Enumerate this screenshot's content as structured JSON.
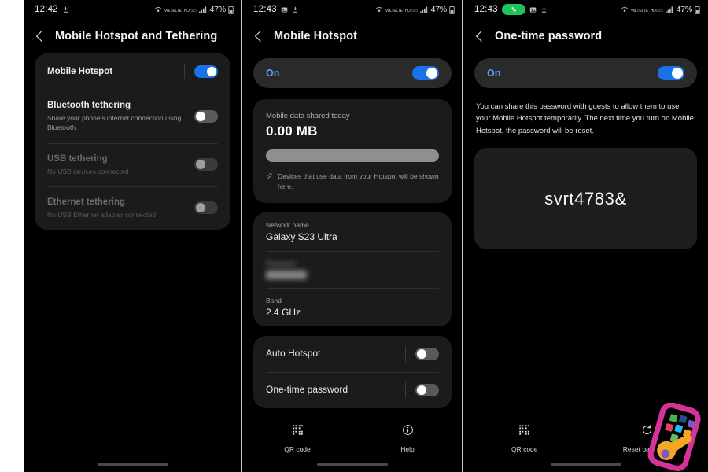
{
  "colors": {
    "accent_blue": "#1b72e8",
    "on_text_blue": "#5b9bf5",
    "call_green": "#1fc25c",
    "card_bg": "#1b1b1b",
    "screen_bg": "#000000",
    "progress_gray": "#8f8f8f"
  },
  "panels": [
    {
      "status_bar": {
        "time": "12:42",
        "battery_percent": "47%",
        "left_icons": [
          "download-icon"
        ],
        "right_icons": [
          "wifi-calling-icon",
          "volte-icon",
          "nfc-icon",
          "signal-bars-icon",
          "battery-icon"
        ]
      },
      "appbar": {
        "back": "back-icon",
        "title": "Mobile Hotspot and Tethering"
      },
      "rows": [
        {
          "title": "Mobile Hotspot",
          "subtitle": "",
          "switch": "on",
          "dim": false,
          "separator_before_switch": true
        },
        {
          "title": "Bluetooth tethering",
          "subtitle": "Share your phone's internet connection using Bluetooth.",
          "switch": "off",
          "dim": false,
          "separator_before_switch": false
        },
        {
          "title": "USB tethering",
          "subtitle": "No USB devices connected",
          "switch": "disabled",
          "dim": true,
          "separator_before_switch": false
        },
        {
          "title": "Ethernet tethering",
          "subtitle": "No USB Ethernet adapter connected",
          "switch": "disabled",
          "dim": true,
          "separator_before_switch": false
        }
      ]
    },
    {
      "status_bar": {
        "time": "12:43",
        "battery_percent": "47%",
        "left_icons": [
          "screenshot-icon",
          "download-icon"
        ],
        "right_icons": [
          "wifi-calling-icon",
          "volte-icon",
          "nfc-icon",
          "signal-bars-icon",
          "battery-icon"
        ]
      },
      "appbar": {
        "back": "back-icon",
        "title": "Mobile Hotspot"
      },
      "on_toggle": {
        "label": "On",
        "state": "on"
      },
      "data_card": {
        "label": "Mobile data shared today",
        "value": "0.00 MB",
        "note": "Devices that use data from your Hotspot will be shown here.",
        "note_icon": "link-icon",
        "progress_percent": 100
      },
      "network_card": [
        {
          "label": "Network name",
          "value": "Galaxy S23 Ultra",
          "blurred": false
        },
        {
          "label": "Password",
          "value": "",
          "blurred": true
        },
        {
          "label": "Band",
          "value": "2.4 GHz",
          "blurred": false
        }
      ],
      "option_rows": [
        {
          "title": "Auto Hotspot",
          "switch": "off"
        },
        {
          "title": "One-time password",
          "switch": "off"
        }
      ],
      "bottom_nav": [
        {
          "label": "QR code",
          "icon": "qr-code-icon"
        },
        {
          "label": "Help",
          "icon": "help-info-icon"
        }
      ]
    },
    {
      "status_bar": {
        "time": "12:43",
        "battery_percent": "47%",
        "left_icons": [
          "call-active-icon",
          "screenshot-icon",
          "download-icon"
        ],
        "right_icons": [
          "wifi-calling-icon",
          "volte-icon",
          "nfc-icon",
          "signal-bars-icon",
          "battery-icon"
        ]
      },
      "appbar": {
        "back": "back-icon",
        "title": "One-time password"
      },
      "on_toggle": {
        "label": "On",
        "state": "on"
      },
      "description": "You can share this password with guests to allow them to use your Mobile Hotspot temporarily. The next time you turn on Mobile Hotspot, the password will be reset.",
      "password": "svrt4783&",
      "bottom_nav": [
        {
          "label": "QR code",
          "icon": "qr-code-icon"
        },
        {
          "label": "Reset password",
          "icon": "reset-refresh-icon"
        }
      ]
    }
  ],
  "watermark": {
    "name": "phone-wrench-logo"
  }
}
